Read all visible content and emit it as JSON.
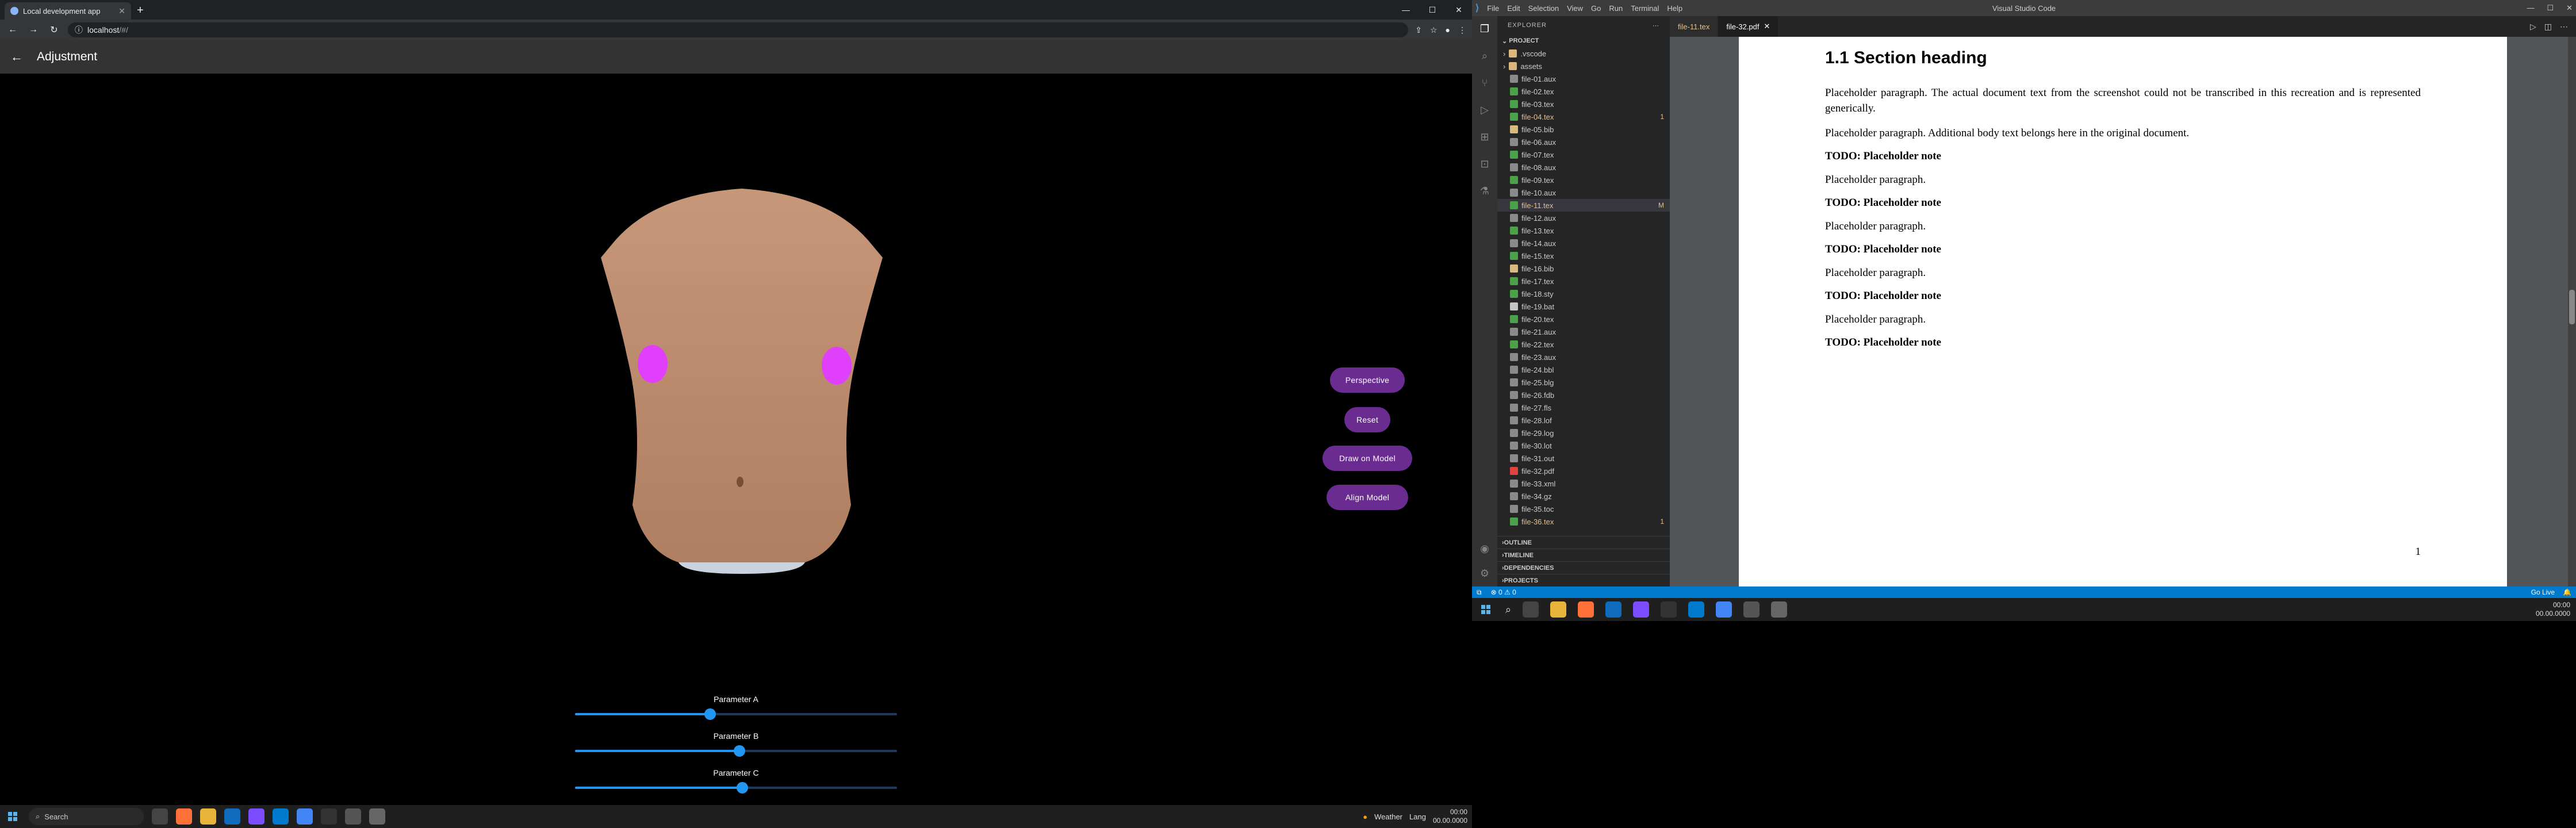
{
  "browser": {
    "tab_title": "Local development app",
    "new_tab": "+",
    "address_host": "localhost",
    "address_rest": "/#/",
    "window_min": "—",
    "window_max": "☐",
    "window_close": "✕"
  },
  "app": {
    "title": "Adjustment",
    "back_label": "←",
    "buttons": {
      "perspective": "Perspective",
      "reset": "Reset",
      "draw": "Draw on Model",
      "align": "Align Model"
    },
    "sliders": [
      {
        "label": "Parameter A",
        "value": 0.42
      },
      {
        "label": "Parameter B",
        "value": 0.51
      },
      {
        "label": "Parameter C",
        "value": 0.52
      }
    ],
    "colors": {
      "button": "#6a2c91",
      "slider": "#2196f3",
      "marker": "#e040fb"
    }
  },
  "left_taskbar": {
    "search_label": "Search",
    "tray_weather": "Weather",
    "tray_lang": "Lang",
    "clock_time": "00:00",
    "clock_date": "00.00.0000"
  },
  "vscode": {
    "window_title": "Visual Studio Code",
    "menu": [
      "File",
      "Edit",
      "Selection",
      "View",
      "Go",
      "Run",
      "Terminal",
      "Help"
    ],
    "explorer_label": "EXPLORER",
    "root_label": "PROJECT",
    "files": [
      {
        "name": ".vscode",
        "kind": "folder"
      },
      {
        "name": "assets",
        "kind": "folder"
      },
      {
        "name": "file-01.aux",
        "kind": "aux"
      },
      {
        "name": "file-02.tex",
        "kind": "tex"
      },
      {
        "name": "file-03.tex",
        "kind": "tex"
      },
      {
        "name": "file-04.tex",
        "kind": "tex",
        "badge": "1",
        "highlight": true
      },
      {
        "name": "file-05.bib",
        "kind": "bib"
      },
      {
        "name": "file-06.aux",
        "kind": "aux"
      },
      {
        "name": "file-07.tex",
        "kind": "tex"
      },
      {
        "name": "file-08.aux",
        "kind": "aux"
      },
      {
        "name": "file-09.tex",
        "kind": "tex"
      },
      {
        "name": "file-10.aux",
        "kind": "aux"
      },
      {
        "name": "file-11.tex",
        "kind": "tex",
        "badge": "M",
        "selected": true,
        "highlight": true
      },
      {
        "name": "file-12.aux",
        "kind": "aux"
      },
      {
        "name": "file-13.tex",
        "kind": "tex"
      },
      {
        "name": "file-14.aux",
        "kind": "aux"
      },
      {
        "name": "file-15.tex",
        "kind": "tex"
      },
      {
        "name": "file-16.bib",
        "kind": "bib"
      },
      {
        "name": "file-17.tex",
        "kind": "tex"
      },
      {
        "name": "file-18.sty",
        "kind": "sty"
      },
      {
        "name": "file-19.bat",
        "kind": "bat"
      },
      {
        "name": "file-20.tex",
        "kind": "tex"
      },
      {
        "name": "file-21.aux",
        "kind": "aux"
      },
      {
        "name": "file-22.tex",
        "kind": "tex"
      },
      {
        "name": "file-23.aux",
        "kind": "aux"
      },
      {
        "name": "file-24.bbl",
        "kind": "aux"
      },
      {
        "name": "file-25.blg",
        "kind": "aux"
      },
      {
        "name": "file-26.fdb",
        "kind": "aux"
      },
      {
        "name": "file-27.fls",
        "kind": "aux"
      },
      {
        "name": "file-28.lof",
        "kind": "aux"
      },
      {
        "name": "file-29.log",
        "kind": "log"
      },
      {
        "name": "file-30.lot",
        "kind": "aux"
      },
      {
        "name": "file-31.out",
        "kind": "aux"
      },
      {
        "name": "file-32.pdf",
        "kind": "pdf"
      },
      {
        "name": "file-33.xml",
        "kind": "aux"
      },
      {
        "name": "file-34.gz",
        "kind": "aux"
      },
      {
        "name": "file-35.toc",
        "kind": "aux"
      },
      {
        "name": "file-36.tex",
        "kind": "tex",
        "badge": "1",
        "highlight": true
      }
    ],
    "sections": [
      "OUTLINE",
      "TIMELINE",
      "DEPENDENCIES",
      "PROJECTS"
    ],
    "tabs": [
      {
        "label": "file-11.tex",
        "active": false
      },
      {
        "label": "file-32.pdf",
        "active": true
      }
    ],
    "status_left": "⊗ 0  ⚠ 0",
    "status_right": [
      "Go Live",
      "🔔"
    ]
  },
  "pdf": {
    "heading": "1.1  Section heading",
    "paragraphs": [
      "Placeholder paragraph. The actual document text from the screenshot could not be transcribed in this recreation and is represented generically.",
      "Placeholder paragraph. Additional body text belongs here in the original document."
    ],
    "blocks": [
      {
        "type": "todo",
        "text": "TODO: Placeholder note"
      },
      {
        "type": "p",
        "text": "Placeholder paragraph."
      },
      {
        "type": "todo",
        "text": "TODO: Placeholder note"
      },
      {
        "type": "p",
        "text": "Placeholder paragraph."
      },
      {
        "type": "todo",
        "text": "TODO: Placeholder note"
      },
      {
        "type": "p",
        "text": "Placeholder paragraph."
      },
      {
        "type": "todo",
        "text": "TODO: Placeholder note"
      },
      {
        "type": "p",
        "text": "Placeholder paragraph."
      },
      {
        "type": "todo",
        "text": "TODO: Placeholder note"
      }
    ],
    "page_number": "1"
  },
  "right_taskbar": {
    "clock_time": "00:00",
    "clock_date": "00.00.0000"
  }
}
